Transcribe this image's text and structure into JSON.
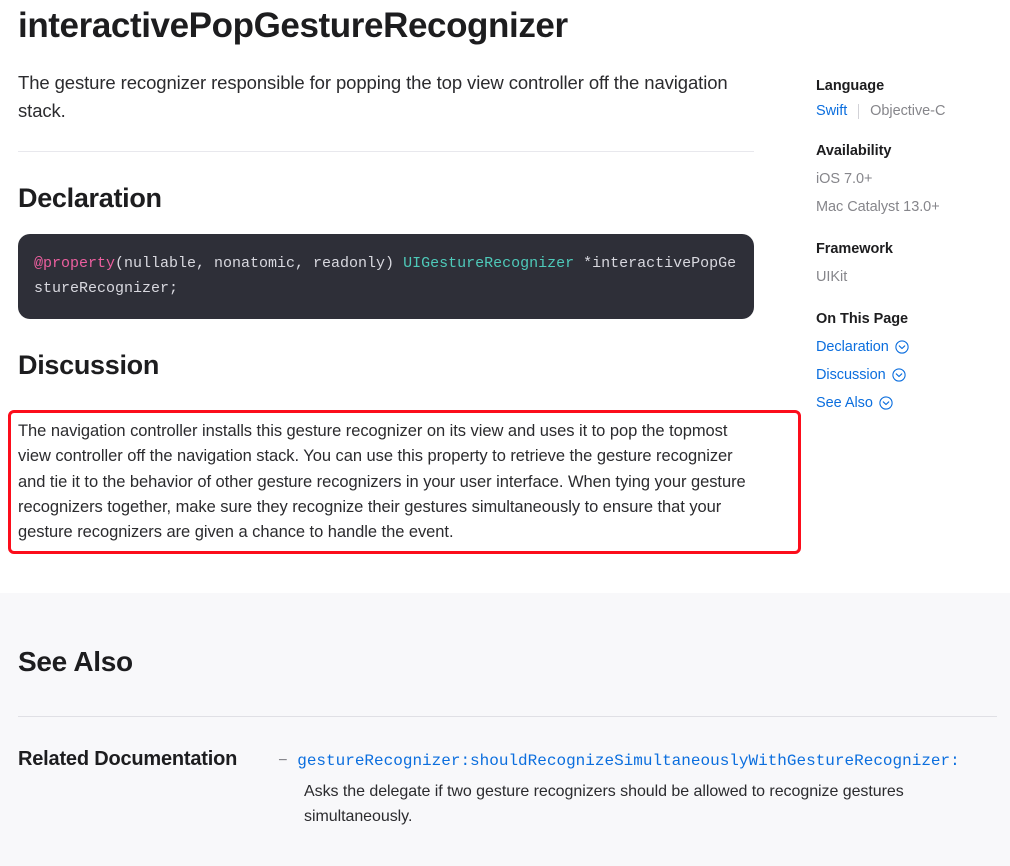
{
  "page": {
    "title": "interactivePopGestureRecognizer",
    "abstract": "The gesture recognizer responsible for popping the top view controller off the navigation stack."
  },
  "declaration": {
    "heading": "Declaration",
    "code": {
      "attribute": "@property",
      "params": "(nullable, nonatomic, readonly) ",
      "type": "UIGestureRecognizer",
      "tail": " *interactivePopGestureRecognizer;"
    }
  },
  "discussion": {
    "heading": "Discussion",
    "body": "The navigation controller installs this gesture recognizer on its view and uses it to pop the topmost view controller off the navigation stack. You can use this property to retrieve the gesture recognizer and tie it to the behavior of other gesture recognizers in your user interface. When tying your gesture recognizers together, make sure they recognize their gestures simultaneously to ensure that your gesture recognizers are given a chance to handle the event.",
    "highlight_color": "#fc0d1b"
  },
  "sidebar": {
    "language": {
      "title": "Language",
      "active": "Swift",
      "inactive": "Objective-C"
    },
    "availability": {
      "title": "Availability",
      "values": [
        "iOS 7.0+",
        "Mac Catalyst 13.0+"
      ]
    },
    "framework": {
      "title": "Framework",
      "value": "UIKit"
    },
    "on_this_page": {
      "title": "On This Page",
      "items": [
        {
          "label": "Declaration",
          "icon": "chevron-down-circle-icon"
        },
        {
          "label": "Discussion",
          "icon": "chevron-down-circle-icon"
        },
        {
          "label": "See Also",
          "icon": "chevron-down-circle-icon"
        }
      ]
    },
    "link_color": "#0b6ede"
  },
  "see_also": {
    "heading": "See Also",
    "related": {
      "label": "Related Documentation",
      "dash": "−",
      "link": "gestureRecognizer:shouldRecognizeSimultaneouslyWithGestureRecognizer:",
      "description": "Asks the delegate if two gesture recognizers should be allowed to recognize gestures simultaneously."
    }
  }
}
